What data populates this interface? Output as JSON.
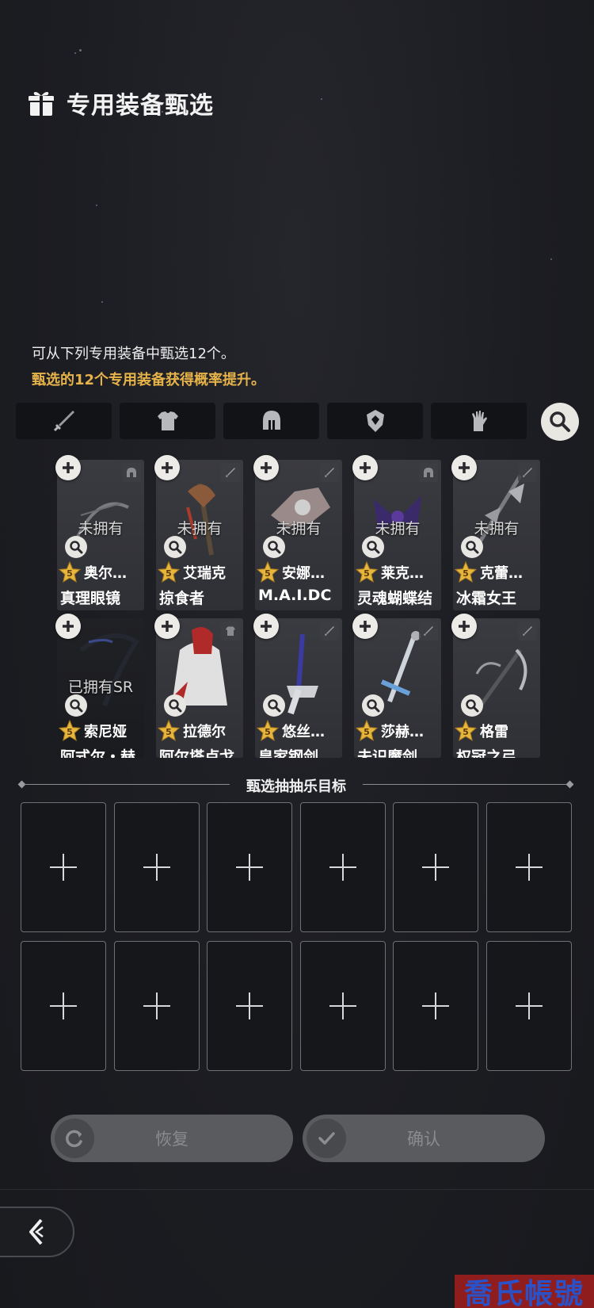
{
  "header": {
    "title": "专用装备甄选",
    "icon": "gift-icon"
  },
  "description": {
    "line1": "可从下列专用装备中甄选12个。",
    "line2": "甄选的12个专用装备获得概率提升。",
    "highlight_color": "#e6b24a"
  },
  "filter_tabs": [
    {
      "icon": "sword-icon"
    },
    {
      "icon": "armor-icon"
    },
    {
      "icon": "helmet-icon"
    },
    {
      "icon": "amulet-icon"
    },
    {
      "icon": "glove-icon"
    }
  ],
  "equipment": [
    {
      "status": "未拥有",
      "stars": "5",
      "hero": "奥尔…",
      "name": "真理眼镜",
      "type": "helmet",
      "art": "bow"
    },
    {
      "status": "未拥有",
      "stars": "5",
      "hero": "艾瑞克",
      "name": "掠食者",
      "type": "sword",
      "art": "axe"
    },
    {
      "status": "未拥有",
      "stars": "5",
      "hero": "安娜…",
      "name": "M.A.I.DC",
      "type": "sword",
      "art": "mech"
    },
    {
      "status": "未拥有",
      "stars": "5",
      "hero": "莱克…",
      "name": "灵魂蝴蝶结",
      "type": "helmet",
      "art": "bow-purple"
    },
    {
      "status": "未拥有",
      "stars": "5",
      "hero": "克蕾…",
      "name": "冰霜女王",
      "type": "sword",
      "art": "staff"
    },
    {
      "status": "已拥有SR",
      "stars": "5",
      "hero": "索尼娅",
      "name": "阿式尔・赫…",
      "type": "",
      "art": "bow-dark"
    },
    {
      "status": "",
      "stars": "5",
      "hero": "拉德尔",
      "name": "阿尔塔卢戈",
      "type": "armor",
      "art": "coat"
    },
    {
      "status": "",
      "stars": "5",
      "hero": "悠丝…",
      "name": "皇家钢剑",
      "type": "sword",
      "art": "blade-blue"
    },
    {
      "status": "",
      "stars": "5",
      "hero": "莎赫…",
      "name": "未识魔剑",
      "type": "sword",
      "art": "greatsword"
    },
    {
      "status": "",
      "stars": "5",
      "hero": "格雷",
      "name": "权冠之弓",
      "type": "sword",
      "art": "scythe"
    }
  ],
  "target_section": {
    "label": "甄选抽抽乐目标",
    "slot_count": 12
  },
  "buttons": {
    "reset": "恢复",
    "confirm": "确认"
  },
  "watermark": "喬氏帳號"
}
